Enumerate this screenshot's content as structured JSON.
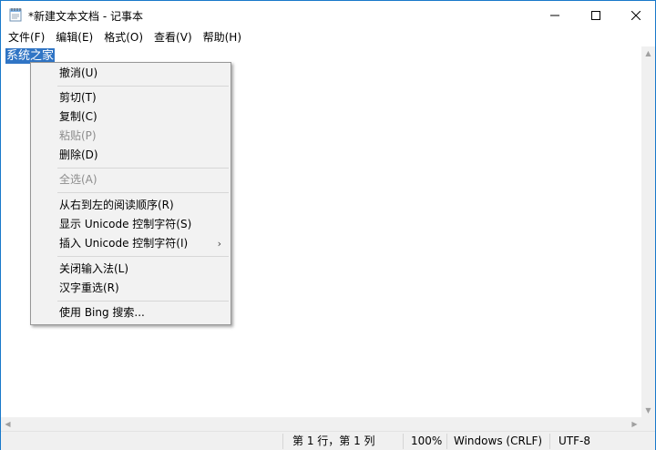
{
  "window": {
    "title": "*新建文本文档 - 记事本",
    "controls": {
      "minimize": "—",
      "maximize": "☐",
      "close": "✕"
    }
  },
  "menubar": [
    "文件(F)",
    "编辑(E)",
    "格式(O)",
    "查看(V)",
    "帮助(H)"
  ],
  "editor": {
    "text": "系统之家",
    "selection_color": "#3075c5"
  },
  "context_menu": {
    "items": [
      {
        "label": "撤消(U)",
        "enabled": true
      },
      {
        "label": "剪切(T)",
        "enabled": true
      },
      {
        "label": "复制(C)",
        "enabled": true
      },
      {
        "label": "粘贴(P)",
        "enabled": false
      },
      {
        "label": "删除(D)",
        "enabled": true
      },
      {
        "label": "全选(A)",
        "enabled": false
      },
      {
        "label": "从右到左的阅读顺序(R)",
        "enabled": true
      },
      {
        "label": "显示 Unicode 控制字符(S)",
        "enabled": true
      },
      {
        "label": "插入 Unicode 控制字符(I)",
        "enabled": true,
        "submenu": true
      },
      {
        "label": "关闭输入法(L)",
        "enabled": true
      },
      {
        "label": "汉字重选(R)",
        "enabled": true
      },
      {
        "label": "使用 Bing 搜索...",
        "enabled": true
      }
    ]
  },
  "statusbar": {
    "position": "第 1 行，第 1 列",
    "zoom": "100%",
    "line_ending": "Windows (CRLF)",
    "encoding": "UTF-8"
  },
  "colors": {
    "window_border": "#1979ca",
    "disabled_text": "#8d8d8d"
  }
}
